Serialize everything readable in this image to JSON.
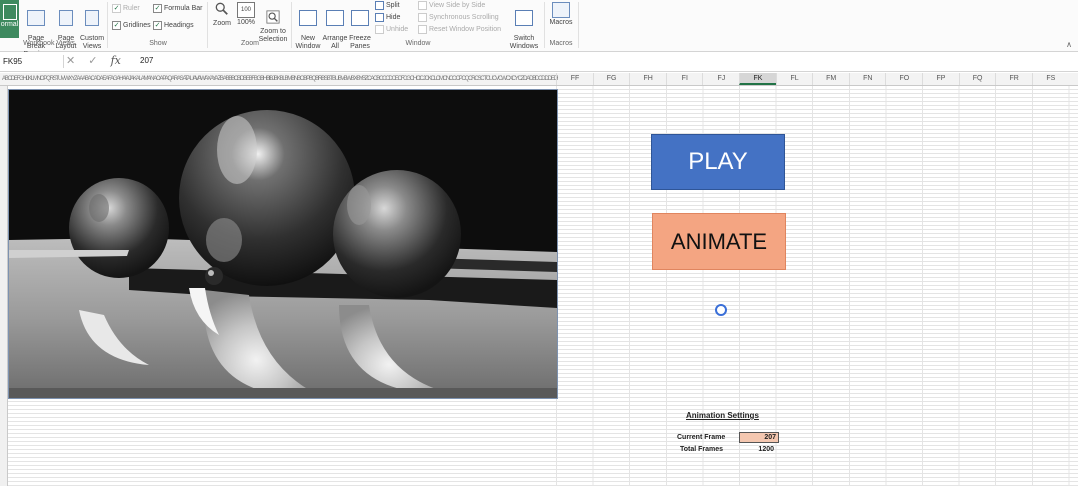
{
  "ribbon": {
    "workbook_views": {
      "normal_label": "ormal",
      "page_break_label": "Page Break\nPreview",
      "page_layout_label": "Page\nLayout",
      "custom_views_label": "Custom\nViews",
      "group_label": "Workbook Views"
    },
    "show": {
      "ruler_label": "Ruler",
      "formula_bar_label": "Formula Bar",
      "gridlines_label": "Gridlines",
      "headings_label": "Headings",
      "group_label": "Show"
    },
    "zoom": {
      "zoom_label": "Zoom",
      "hundred_label": "100%",
      "zoom_selection_label": "Zoom to\nSelection",
      "group_label": "Zoom"
    },
    "window": {
      "new_window_label": "New\nWindow",
      "arrange_all_label": "Arrange\nAll",
      "freeze_panes_label": "Freeze\nPanes",
      "split_label": "Split",
      "hide_label": "Hide",
      "unhide_label": "Unhide",
      "side_by_side_label": "View Side by Side",
      "sync_scroll_label": "Synchronous Scrolling",
      "reset_pos_label": "Reset Window Position",
      "switch_windows_label": "Switch\nWindows",
      "group_label": "Window"
    },
    "macros": {
      "macros_label": "Macros",
      "group_label": "Macros"
    }
  },
  "formula_bar": {
    "name_box": "FK95",
    "cancel_glyph": "✕",
    "enter_glyph": "✓",
    "fx_glyph": "fx",
    "value": "207"
  },
  "columns": {
    "squeezed_headers": "ABCDEFGHIJKLMNOPQRSTUVWXYZAAABACADAEAFAGAHAIAJAKALAMANAOAPAQARASATAUAVAWAXAYAZBABBBCBDBEBFBGBHBIBJBKBLBMBNBOBPBQBRBSBTBUBVBWBXBYBZCACBCCCDCECFCGCHCICJCKCLCMCNCOCPCQCRCSCTCUCVCWCXCYCZDADBDCDDDEDFDGDHDIDJDKDLDMDNDODPDQDRDSDTDUDVDWDXDYDZEAEBECEDEEEFEGEHEIEJEKELEMENEOEPEQERESETEUEVEWEXEYEZFAFBFCFDFE",
    "labels": [
      "FF",
      "FG",
      "FH",
      "FI",
      "FJ",
      "FK",
      "FL",
      "FM",
      "FN",
      "FO",
      "FP",
      "FQ",
      "FR",
      "FS"
    ],
    "selected": "FK"
  },
  "buttons": {
    "play_label": "PLAY",
    "animate_label": "ANIMATE"
  },
  "settings": {
    "title": "Animation Settings",
    "current_frame_label": "Current Frame",
    "current_frame_value": "207",
    "total_frames_label": "Total Frames",
    "total_frames_value": "1200"
  },
  "colors": {
    "excel_green": "#217346",
    "play_blue": "#4472c4",
    "animate_salmon": "#f4a582",
    "current_frame_fill": "#f4c7b0"
  }
}
